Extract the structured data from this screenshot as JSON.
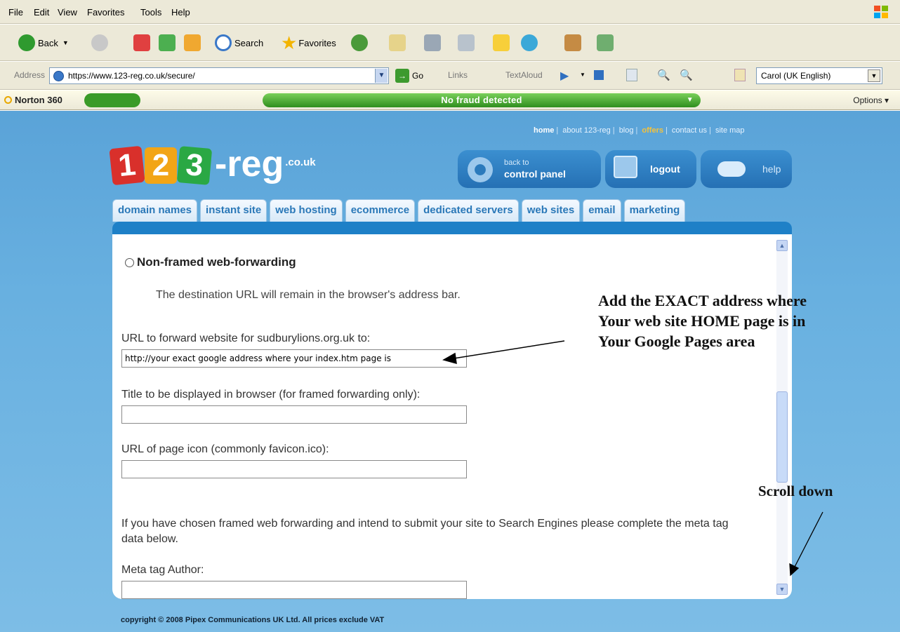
{
  "menu": [
    "File",
    "Edit",
    "View",
    "Favorites",
    "Tools",
    "Help"
  ],
  "toolbar": {
    "back": "Back",
    "search": "Search",
    "favorites": "Favorites"
  },
  "address": {
    "label": "Address",
    "url": "https://www.123-reg.co.uk/secure/",
    "go": "Go",
    "links": "Links",
    "textaloud": "TextAloud",
    "voice": "Carol (UK English)"
  },
  "norton": {
    "name": "Norton 360",
    "status": "No fraud detected",
    "options": "Options"
  },
  "site": {
    "toplinks": [
      "home",
      "about 123-reg",
      "blog",
      "offers",
      "contact us",
      "site map"
    ],
    "logo": {
      "digits": [
        "1",
        "2",
        "3"
      ],
      "reg": "-reg",
      "tld": ".co.uk"
    },
    "buttons": {
      "cp_small": "back to",
      "cp_big": "control panel",
      "logout": "logout",
      "help": "help"
    },
    "tabs": [
      "domain names",
      "instant site",
      "web hosting",
      "ecommerce",
      "dedicated servers",
      "web sites",
      "email",
      "marketing"
    ]
  },
  "form": {
    "radio_label": "Non-framed web-forwarding",
    "description": "The destination URL will remain in the browser's address bar.",
    "url_label": "URL to forward website for sudburylions.org.uk to:",
    "url_value": "http://your exact google address where your index.htm page is",
    "title_label": "Title to be displayed in browser (for framed forwarding only):",
    "title_value": "",
    "icon_label": "URL of page icon (commonly favicon.ico):",
    "icon_value": "",
    "note": "If you have chosen framed web forwarding and intend to submit your site to Search Engines please complete the meta tag data below.",
    "meta_author_label": "Meta tag Author:"
  },
  "footer": "copyright © 2008 Pipex Communications UK Ltd. All prices exclude VAT",
  "annotations": {
    "main": [
      "Add the EXACT address where",
      "Your web site HOME page is in",
      "Your Google Pages area"
    ],
    "scroll": "Scroll down"
  }
}
